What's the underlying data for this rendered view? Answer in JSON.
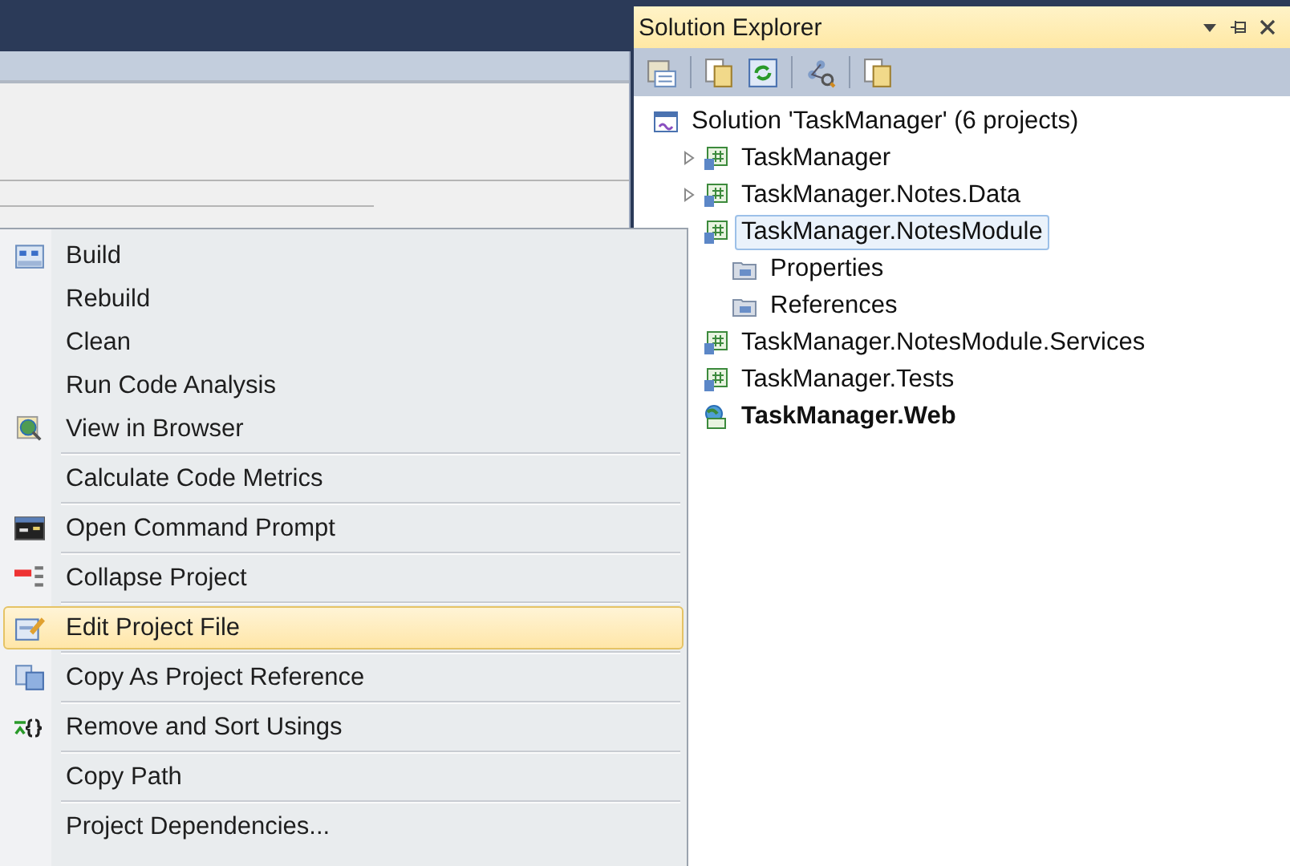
{
  "solution_explorer": {
    "title": "Solution Explorer",
    "toolbar": [
      {
        "kind": "properties"
      },
      {
        "kind": "showall"
      },
      {
        "kind": "refresh"
      },
      {
        "kind": "diagram"
      },
      {
        "kind": "showall"
      }
    ],
    "tree": [
      {
        "label": "Solution 'TaskManager' (6 projects)",
        "kind": "solution",
        "selected": false,
        "bold": false,
        "children": [
          {
            "label": "TaskManager",
            "kind": "project",
            "selected": false,
            "bold": false,
            "expanded": false
          },
          {
            "label": "TaskManager.Notes.Data",
            "kind": "project",
            "selected": false,
            "bold": false,
            "expanded": false
          },
          {
            "label": "TaskManager.NotesModule",
            "kind": "project",
            "selected": true,
            "bold": false,
            "children": [
              {
                "label": "Properties",
                "kind": "folder",
                "selected": false,
                "bold": false
              },
              {
                "label": "References",
                "kind": "folder",
                "selected": false,
                "bold": false
              }
            ]
          },
          {
            "label": "TaskManager.NotesModule.Services",
            "kind": "project",
            "selected": false,
            "bold": false
          },
          {
            "label": "TaskManager.Tests",
            "kind": "project",
            "selected": false,
            "bold": false
          },
          {
            "label": "TaskManager.Web",
            "kind": "web",
            "selected": false,
            "bold": true
          }
        ]
      }
    ]
  },
  "context_menu": {
    "items": [
      {
        "label": "Build",
        "kind": "build",
        "selected": false
      },
      {
        "label": "Rebuild",
        "selected": false
      },
      {
        "label": "Clean",
        "selected": false
      },
      {
        "label": "Run Code Analysis",
        "selected": false
      },
      {
        "label": "View in Browser",
        "kind": "browser",
        "selected": false
      },
      {
        "kind": "separator"
      },
      {
        "label": "Calculate Code Metrics",
        "selected": false
      },
      {
        "kind": "separator"
      },
      {
        "label": "Open Command Prompt",
        "kind": "console",
        "selected": false
      },
      {
        "kind": "separator"
      },
      {
        "label": "Collapse Project",
        "kind": "collapse",
        "selected": false
      },
      {
        "kind": "separator"
      },
      {
        "label": "Edit Project File",
        "kind": "edit",
        "selected": true
      },
      {
        "kind": "separator"
      },
      {
        "label": "Copy As Project Reference",
        "kind": "copy",
        "selected": false
      },
      {
        "kind": "separator"
      },
      {
        "label": "Remove and Sort Usings",
        "kind": "usings",
        "selected": false
      },
      {
        "kind": "separator"
      },
      {
        "label": "Copy Path",
        "selected": false
      },
      {
        "kind": "separator"
      },
      {
        "label": "Project Dependencies...",
        "selected": false
      }
    ]
  }
}
